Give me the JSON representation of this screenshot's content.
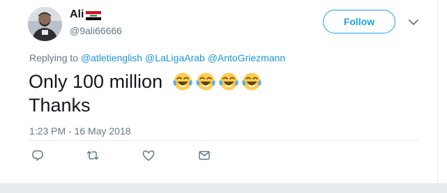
{
  "user": {
    "display_name": "Ali",
    "handle": "@9ali66666",
    "flag_icon": "iraq-flag-icon",
    "avatar_icon": "user-avatar"
  },
  "actions": {
    "follow_label": "Follow",
    "more_icon": "chevron-down-icon"
  },
  "reply": {
    "prefix": "Replying to",
    "mentions": [
      "@atletienglish",
      "@LaLigaArab",
      "@AntoGriezmann"
    ]
  },
  "tweet": {
    "line1": "Only 100 million",
    "line2": "Thanks",
    "emoji_icons": [
      "face-with-tears-of-joy-icon",
      "face-with-tears-of-joy-icon",
      "face-with-tears-of-joy-icon",
      "face-with-tears-of-joy-icon"
    ]
  },
  "timestamp": "1:23 PM - 16 May 2018",
  "footer_icons": [
    "reply-icon",
    "retweet-icon",
    "like-icon",
    "direct-message-icon"
  ],
  "colors": {
    "accent": "#1da1f2",
    "mention": "#1b95e0",
    "secondary_text": "#657786",
    "divider": "#e6ecf0"
  }
}
